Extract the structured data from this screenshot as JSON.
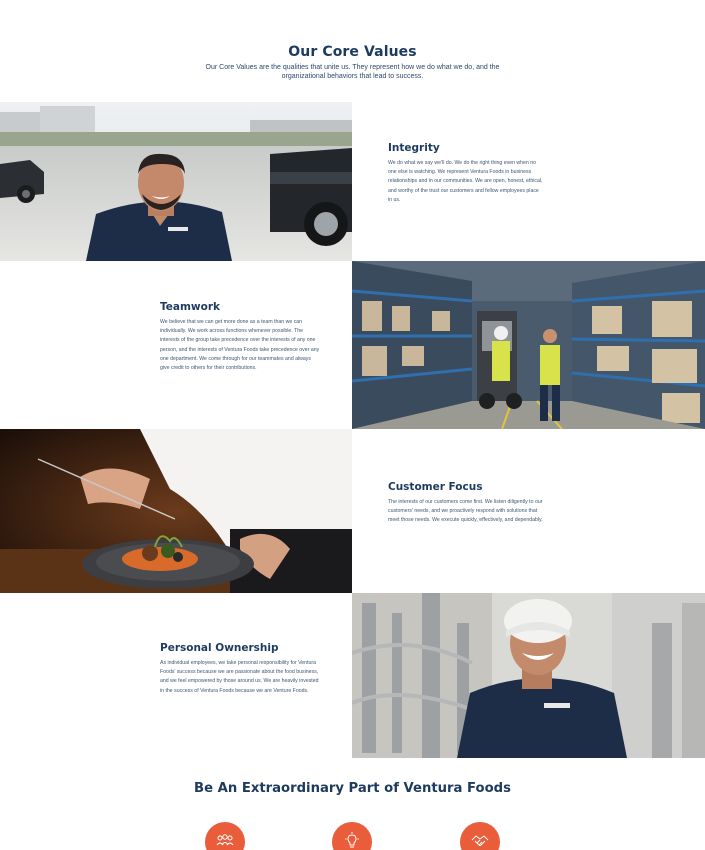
{
  "header": {
    "title": "Our Core Values",
    "subtitle": "Our Core Values are the qualities that unite us. They represent how we do what we do, and the organizational behaviors that lead to success."
  },
  "values": [
    {
      "title": "Integrity",
      "body": "We do what we say we’ll do. We do the right thing even when no one else is watching. We represent Ventura Foods in business relationships and in our communities. We are open, honest, ethical, and worthy of the trust our customers and fellow employees place in us.",
      "photo": "smiling-employee-by-truck-photo"
    },
    {
      "title": "Teamwork",
      "body": "We believe that we can get more done as a team than we can individually. We work across functions whenever possible. The interests of the group take precedence over the interests of any one person, and the interests of Ventura Foods take precedence over any one department. We come through for our teammates and always give credit to others for their contributions.",
      "photo": "warehouse-workers-forklift-photo"
    },
    {
      "title": "Customer Focus",
      "body": "The interests of our customers come first. We listen diligently to our customers’ needs, and we proactively respond with solutions that meet those needs. We execute quickly, effectively, and dependably.",
      "photo": "chef-plating-dish-photo"
    },
    {
      "title": "Personal Ownership",
      "body": "As individual employees, we take personal responsibility for Ventura Foods’ success because we are passionate about the food business, and we feel empowered by those around us. We are heavily invested in the success of Ventura Foods because we are Venture Foods.",
      "photo": "smiling-factory-worker-hairnet-photo"
    }
  ],
  "extraordinary": {
    "title": "Be An Extraordinary Part of Ventura Foods"
  },
  "feature_icons": [
    "people-icon",
    "lightbulb-icon",
    "handshake-icon"
  ],
  "colors": {
    "navy": "#1d3a5f",
    "body_text": "#3e5673",
    "accent": "#ea5d3a",
    "shirt": "#1d2d48"
  }
}
